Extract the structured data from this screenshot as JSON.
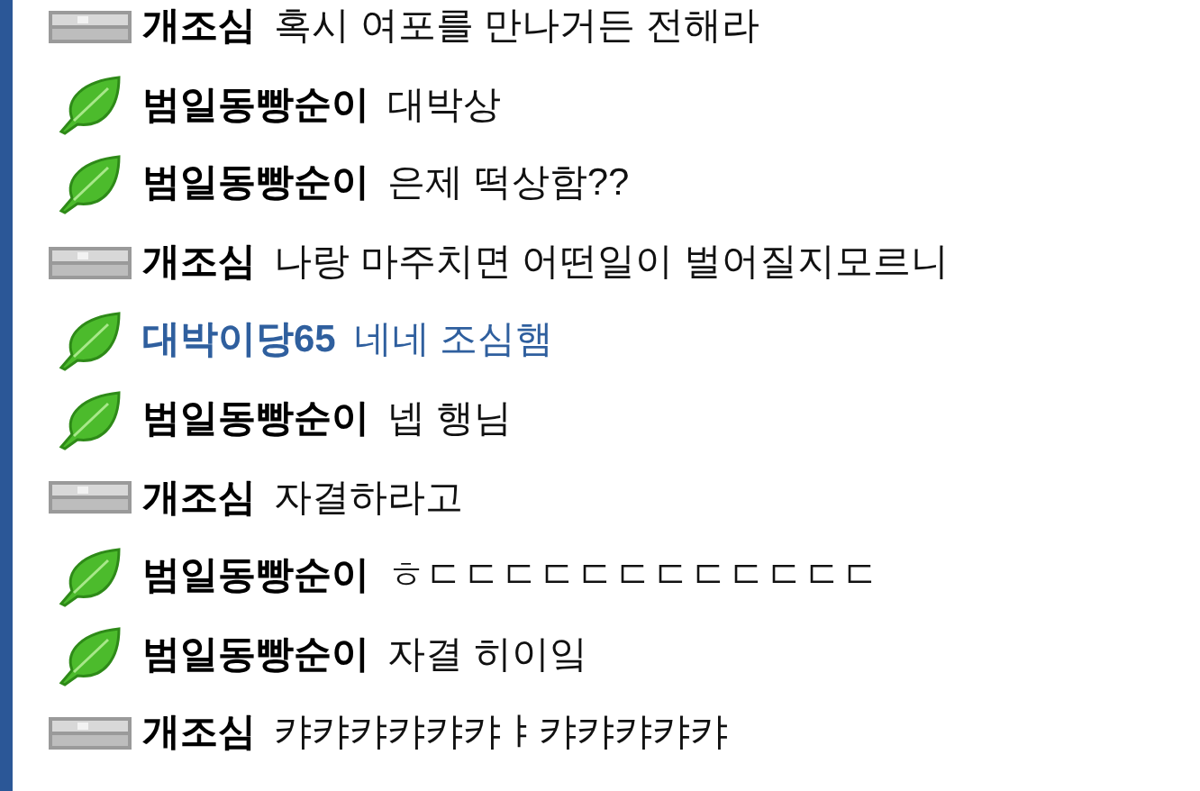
{
  "messages": [
    {
      "kind": "server",
      "name": "개조심",
      "text": "혹시 여포를 만나거든 전해라",
      "highlight": false
    },
    {
      "kind": "leaf",
      "name": "범일동빵순이",
      "text": "대박상",
      "highlight": false
    },
    {
      "kind": "leaf",
      "name": "범일동빵순이",
      "text": "은제 떡상함??",
      "highlight": false
    },
    {
      "kind": "server",
      "name": "개조심",
      "text": "나랑 마주치면 어떤일이 벌어질지모르니",
      "highlight": false
    },
    {
      "kind": "leaf",
      "name": "대박이당65",
      "text": "네네 조심햄",
      "highlight": true
    },
    {
      "kind": "leaf",
      "name": "범일동빵순이",
      "text": "넵 행님",
      "highlight": false
    },
    {
      "kind": "server",
      "name": "개조심",
      "text": "자결하라고",
      "highlight": false
    },
    {
      "kind": "leaf",
      "name": "범일동빵순이",
      "text": "ㅎㄷㄷㄷㄷㄷㄷㄷㄷㄷㄷㄷㄷ",
      "highlight": false
    },
    {
      "kind": "leaf",
      "name": "범일동빵순이",
      "text": "자결 히이잌",
      "highlight": false
    },
    {
      "kind": "server",
      "name": "개조심",
      "text": "캬캬캬캬캬캬ㅑ캬캬캬캬캬",
      "highlight": false
    }
  ]
}
